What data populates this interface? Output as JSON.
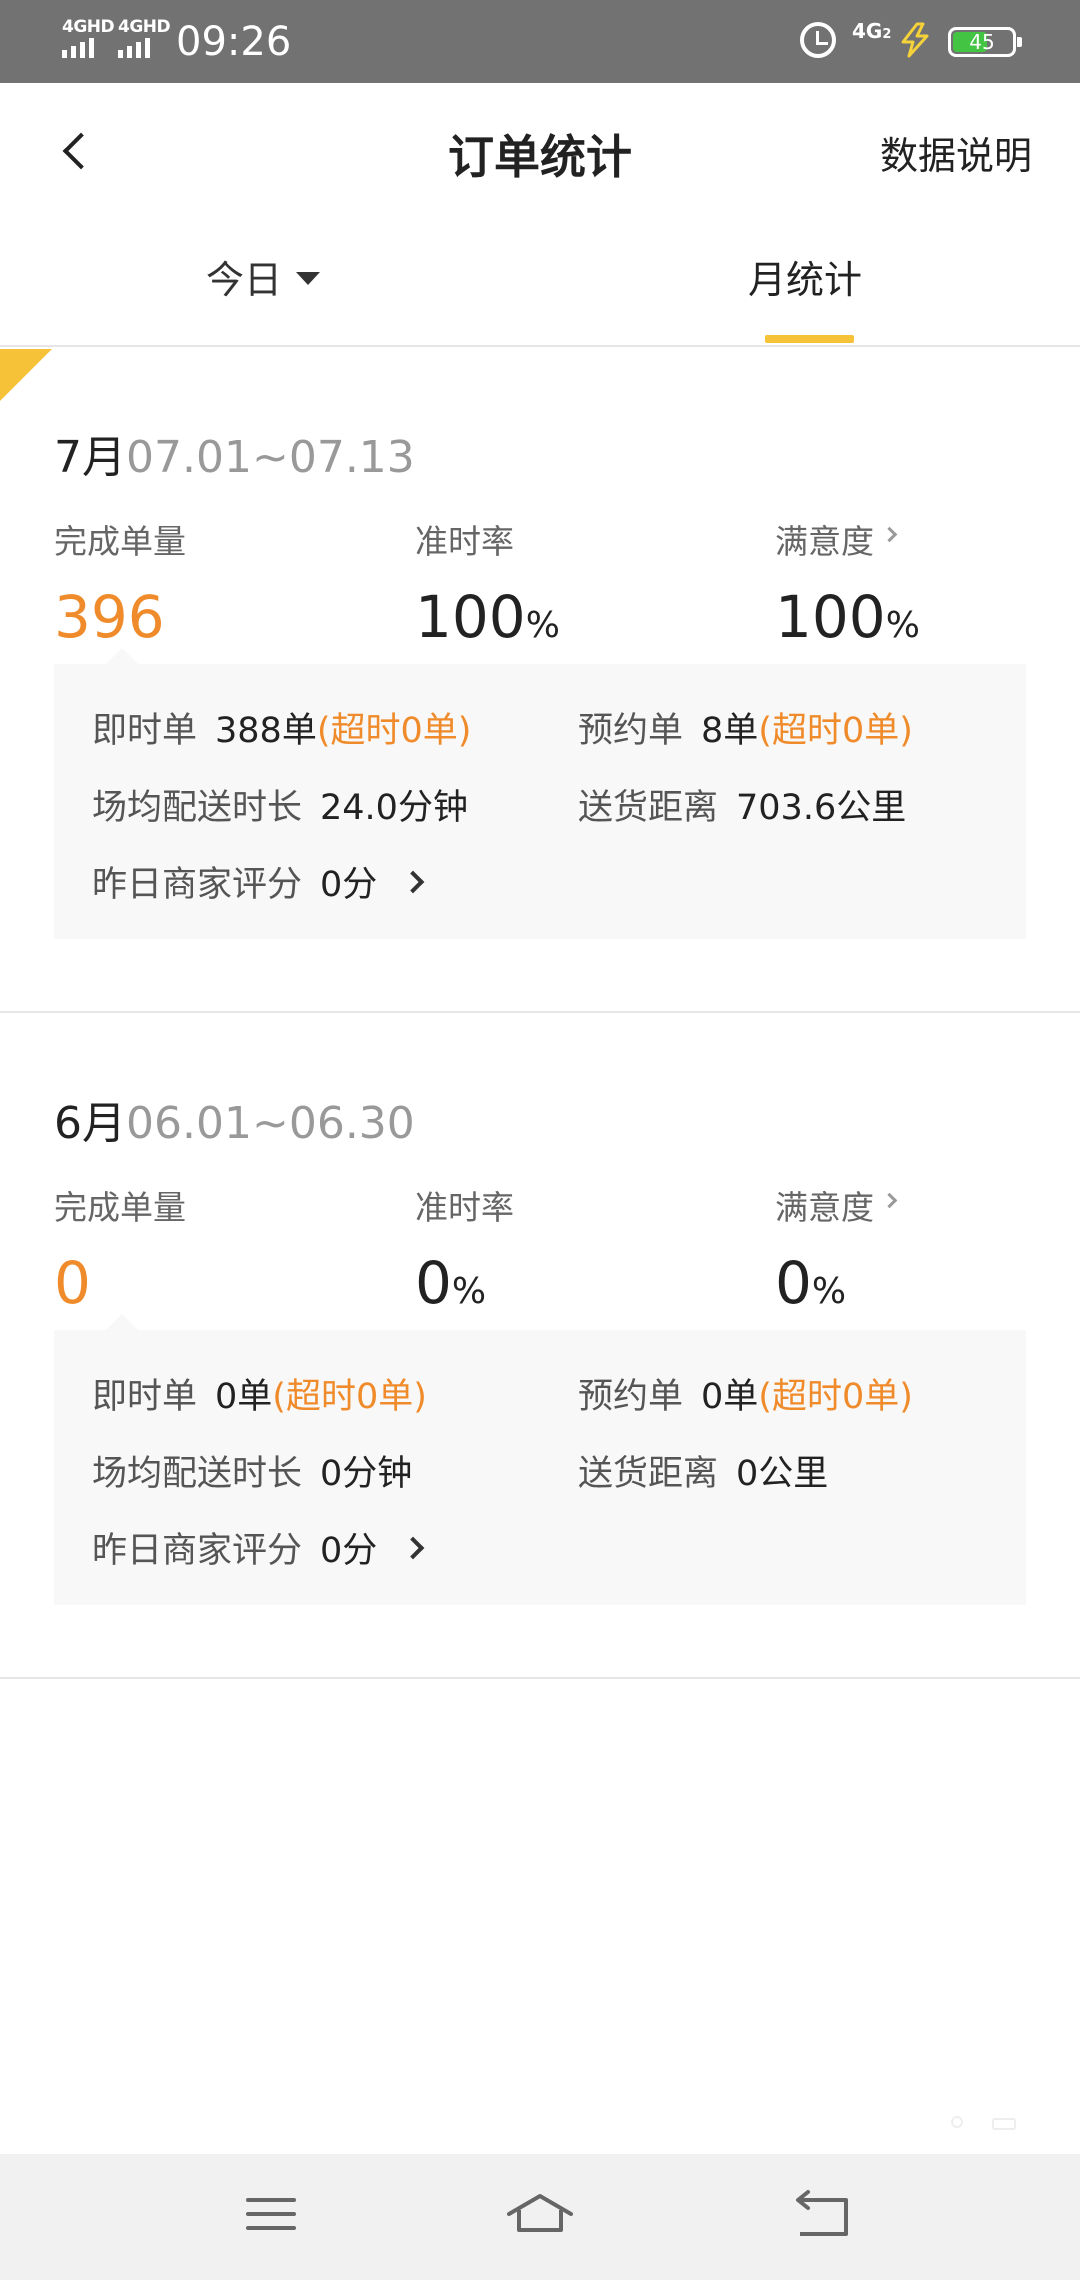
{
  "status_bar": {
    "signal1": "4GHD",
    "signal2": "4GHD",
    "time": "09:26",
    "network": "4G",
    "network_sub": "2",
    "battery": "45",
    "battery_color": "#43c443"
  },
  "header": {
    "title": "订单统计",
    "right_action": "数据说明"
  },
  "tabs": {
    "today": "今日",
    "month": "月统计",
    "active_color": "#f5c238"
  },
  "months": [
    {
      "month": "7月",
      "range": "07.01~07.13",
      "completed_label": "完成单量",
      "completed_value": "396",
      "ontime_label": "准时率",
      "ontime_value": "100",
      "ontime_unit": "%",
      "satisfaction_label": "满意度",
      "satisfaction_value": "100",
      "satisfaction_unit": "%",
      "instant_label": "即时单",
      "instant_value": "388单",
      "instant_overtime": "(超时0单)",
      "reserve_label": "预约单",
      "reserve_value": "8单",
      "reserve_overtime": "(超时0单)",
      "avg_time_label": "场均配送时长",
      "avg_time_value": "24.0分钟",
      "distance_label": "送货距离",
      "distance_value": "703.6公里",
      "merchant_label": "昨日商家评分",
      "merchant_value": "0分"
    },
    {
      "month": "6月",
      "range": "06.01~06.30",
      "completed_label": "完成单量",
      "completed_value": "0",
      "ontime_label": "准时率",
      "ontime_value": "0",
      "ontime_unit": "%",
      "satisfaction_label": "满意度",
      "satisfaction_value": "0",
      "satisfaction_unit": "%",
      "instant_label": "即时单",
      "instant_value": "0单",
      "instant_overtime": "(超时0单)",
      "reserve_label": "预约单",
      "reserve_value": "0单",
      "reserve_overtime": "(超时0单)",
      "avg_time_label": "场均配送时长",
      "avg_time_value": "0分钟",
      "distance_label": "送货距离",
      "distance_value": "0公里",
      "merchant_label": "昨日商家评分",
      "merchant_value": "0分"
    }
  ],
  "accent_color": "#f08b2b",
  "nav_icons": [
    "menu-icon",
    "home-icon",
    "back-icon"
  ]
}
